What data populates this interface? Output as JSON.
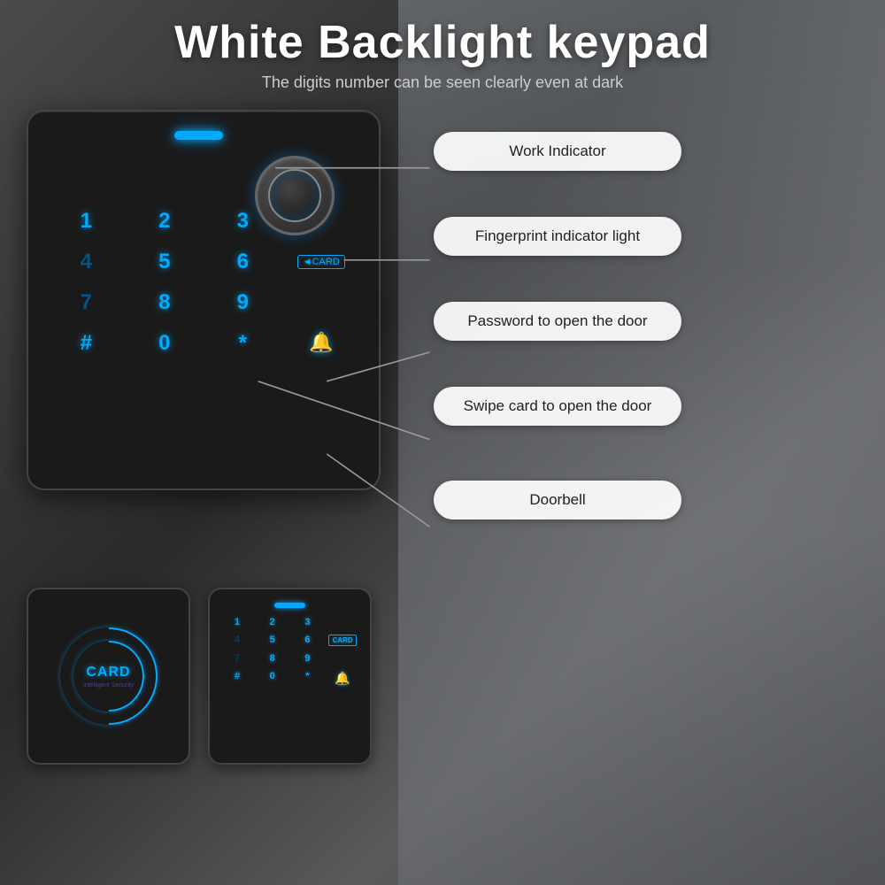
{
  "header": {
    "title": "White Backlight keypad",
    "subtitle": "The digits number can be seen clearly even at dark"
  },
  "labels": {
    "work_indicator": "Work Indicator",
    "fingerprint": "Fingerprint indicator light",
    "password": "Password to open the door",
    "swipe_card": "Swipe card to open the door",
    "doorbell": "Doorbell"
  },
  "keypad": {
    "keys": [
      "1",
      "2",
      "3",
      "",
      "4",
      "5",
      "6",
      "",
      "7",
      "8",
      "9",
      "CARD",
      "#",
      "0",
      "*",
      "BELL"
    ],
    "small_keys": [
      "1",
      "2",
      "3",
      "",
      "4",
      "5",
      "6",
      "CARD",
      "7",
      "8",
      "9",
      "",
      "#",
      "0",
      "*",
      "BELL"
    ]
  },
  "card_reader": {
    "label": "CARD",
    "sublabel": "Intelligent Security"
  }
}
